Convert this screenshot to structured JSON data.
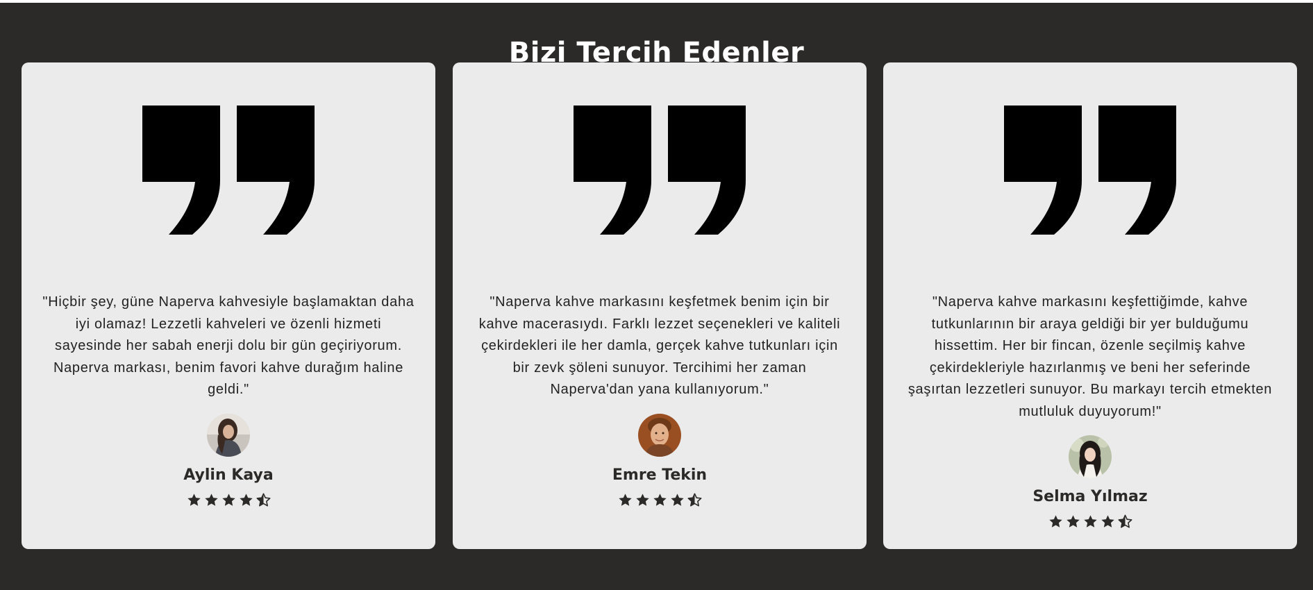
{
  "section": {
    "title": "Bizi Tercih Edenler"
  },
  "colors": {
    "background": "#2b2a28",
    "card": "#ebebeb",
    "quote_icon": "#000000",
    "text": "#222222",
    "star": "#2b2a28"
  },
  "testimonials": [
    {
      "text": "\"Hiçbir şey, güne Naperva kahvesiyle başlamaktan daha iyi olamaz! Lezzetli kahveleri ve özenli hizmeti sayesinde her sabah enerji dolu bir gün geçiriyorum. Naperva markası, benim favori kahve durağım haline geldi.\"",
      "author": "Aylin Kaya",
      "rating": 4.5,
      "icon": "quote-icon"
    },
    {
      "text": "\"Naperva kahve markasını keşfetmek benim için bir kahve macerasıydı. Farklı lezzet seçenekleri ve kaliteli çekirdekleri ile her damla, gerçek kahve tutkunları için bir zevk şöleni sunuyor. Tercihimi her zaman Naperva'dan yana kullanıyorum.\"",
      "author": "Emre Tekin",
      "rating": 4.5,
      "icon": "quote-icon"
    },
    {
      "text": "\"Naperva kahve markasını keşfettiğimde, kahve tutkunlarının bir araya geldiği bir yer bulduğumu hissettim. Her bir fincan, özenle seçilmiş kahve çekirdekleriyle hazırlanmış ve beni her seferinde şaşırtan lezzetleri sunuyor. Bu markayı tercih etmekten mutluluk duyuyorum!\"",
      "author": "Selma Yılmaz",
      "rating": 4.5,
      "icon": "quote-icon"
    }
  ]
}
